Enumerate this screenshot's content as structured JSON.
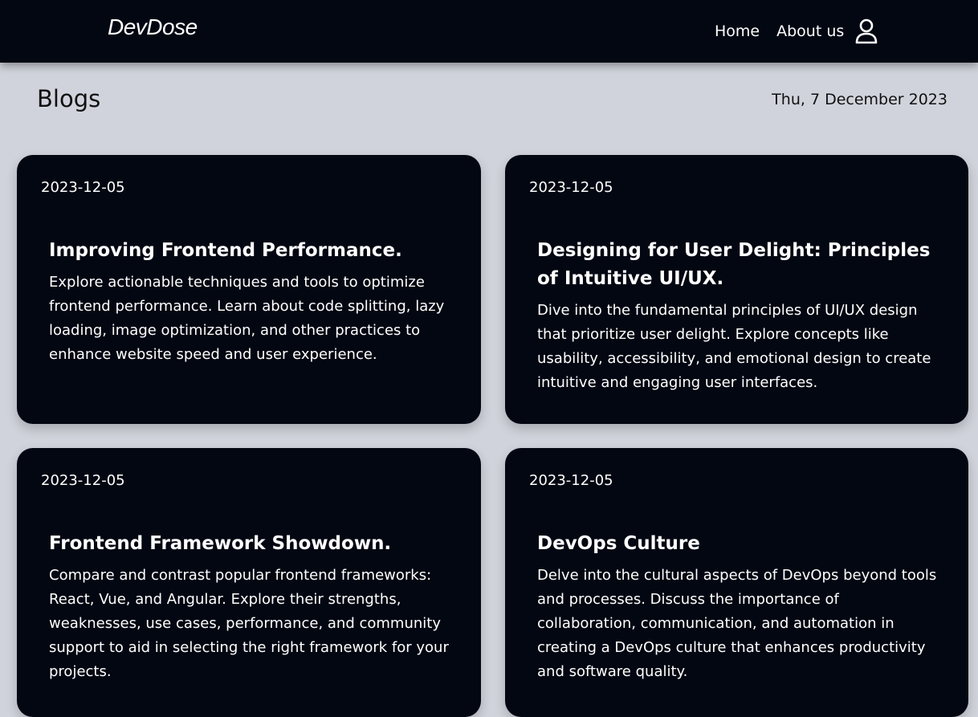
{
  "navbar": {
    "brand": "DevDose",
    "links": [
      {
        "label": "Home"
      },
      {
        "label": "About us"
      }
    ],
    "user_icon": "user-icon"
  },
  "page": {
    "title": "Blogs",
    "date": "Thu, 7 December 2023"
  },
  "posts": [
    {
      "date": "2023-12-05",
      "title": "Improving Frontend Performance.",
      "description": "Explore actionable techniques and tools to optimize frontend performance. Learn about code splitting, lazy loading, image optimization, and other practices to enhance website speed and user experience."
    },
    {
      "date": "2023-12-05",
      "title": "Designing for User Delight: Principles of Intuitive UI/UX.",
      "description": "Dive into the fundamental principles of UI/UX design that prioritize user delight. Explore concepts like usability, accessibility, and emotional design to create intuitive and engaging user interfaces."
    },
    {
      "date": "2023-12-05",
      "title": "Frontend Framework Showdown.",
      "description": "Compare and contrast popular frontend frameworks: React, Vue, and Angular. Explore their strengths, weaknesses, use cases, performance, and community support to aid in selecting the right framework for your projects."
    },
    {
      "date": "2023-12-05",
      "title": "DevOps Culture",
      "description": "Delve into the cultural aspects of DevOps beyond tools and processes. Discuss the importance of collaboration, communication, and automation in creating a DevOps culture that enhances productivity and software quality."
    }
  ],
  "colors": {
    "background": "#d1d3dc",
    "navbar": "#030712",
    "card": "#030712",
    "text_on_dark": "#ffffff"
  }
}
